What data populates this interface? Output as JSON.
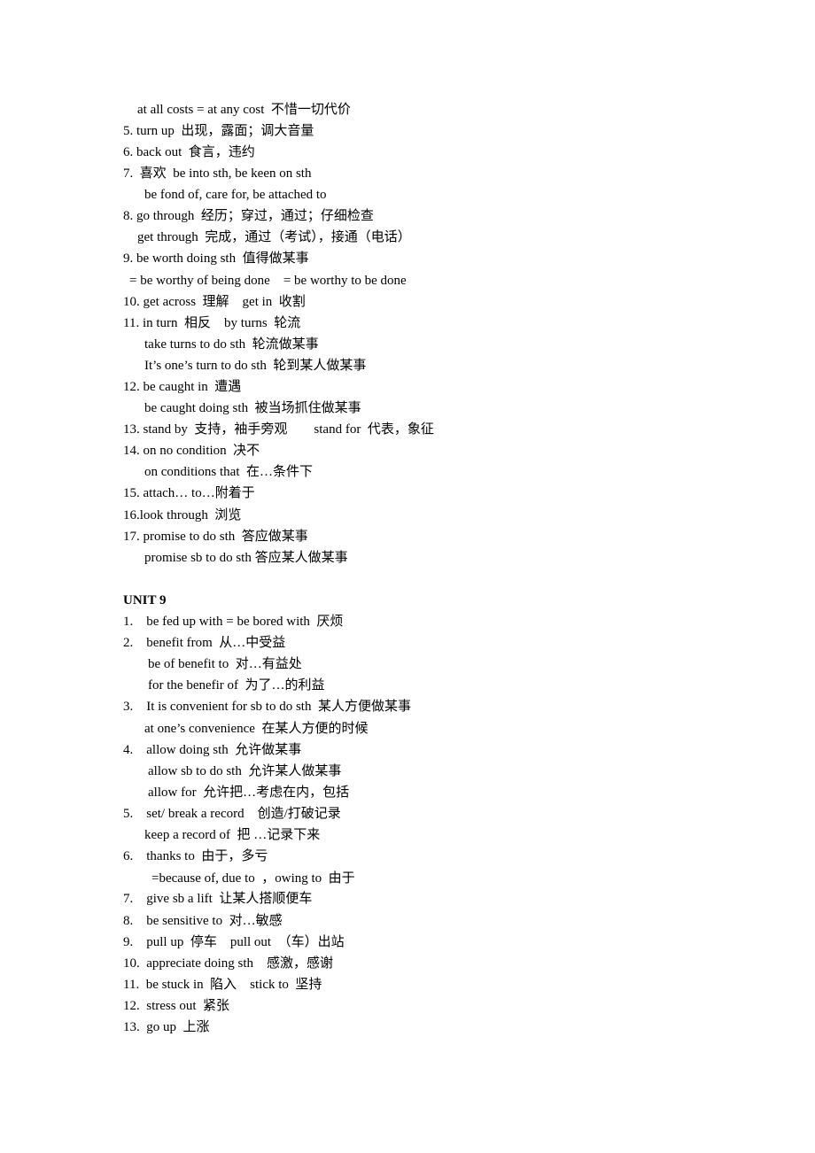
{
  "document": {
    "sections": [
      {
        "lines": [
          "at all costs = at any cost  不惜一切代价",
          "5. turn up  出现，露面；调大音量",
          "6. back out  食言，违约",
          "7.  喜欢  be into sth, be keen on sth",
          "be fond of, care for, be attached to",
          "8. go through  经历；穿过，通过；仔细检查",
          "get through  完成，通过（考试），接通（电话）",
          "9. be worth doing sth  值得做某事",
          "= be worthy of being done    = be worthy to be done",
          "10. get across  理解    get in  收割",
          "11. in turn  相反    by turns  轮流",
          "take turns to do sth  轮流做某事",
          "It’s one’s turn to do sth  轮到某人做某事",
          "12. be caught in  遭遇",
          "be caught doing sth  被当场抓住做某事",
          "13. stand by  支持，袖手旁观        stand for  代表，象征",
          "14. on no condition  决不",
          "on conditions that  在…条件下",
          "15. attach… to…附着于",
          "16.look through  浏览",
          "17. promise to do sth  答应做某事",
          "promise sb to do sth 答应某人做某事"
        ]
      },
      {
        "heading": "UNIT 9",
        "lines": [
          "1.    be fed up with = be bored with  厌烦",
          "2.    benefit from  从…中受益",
          "be of benefit to  对…有益处",
          "for the benefir of  为了…的利益",
          "3.    It is convenient for sb to do sth  某人方便做某事",
          "at one’s convenience  在某人方便的时候",
          "4.    allow doing sth  允许做某事",
          "allow sb to do sth  允许某人做某事",
          "allow for  允许把…考虑在内，包括",
          "5.    set/ break a record    创造/打破记录",
          "keep a record of  把 …记录下来",
          "6.    thanks to  由于，多亏",
          "=because of, due to  ，owing to  由于",
          "7.    give sb a lift  让某人搭顺便车",
          "8.    be sensitive to  对…敏感",
          "9.    pull up  停车    pull out  （车）出站",
          "10.  appreciate doing sth    感激，感谢",
          "11.  be stuck in  陷入    stick to  坚持",
          "12.  stress out  紧张",
          "13.  go up  上涨"
        ]
      }
    ]
  }
}
